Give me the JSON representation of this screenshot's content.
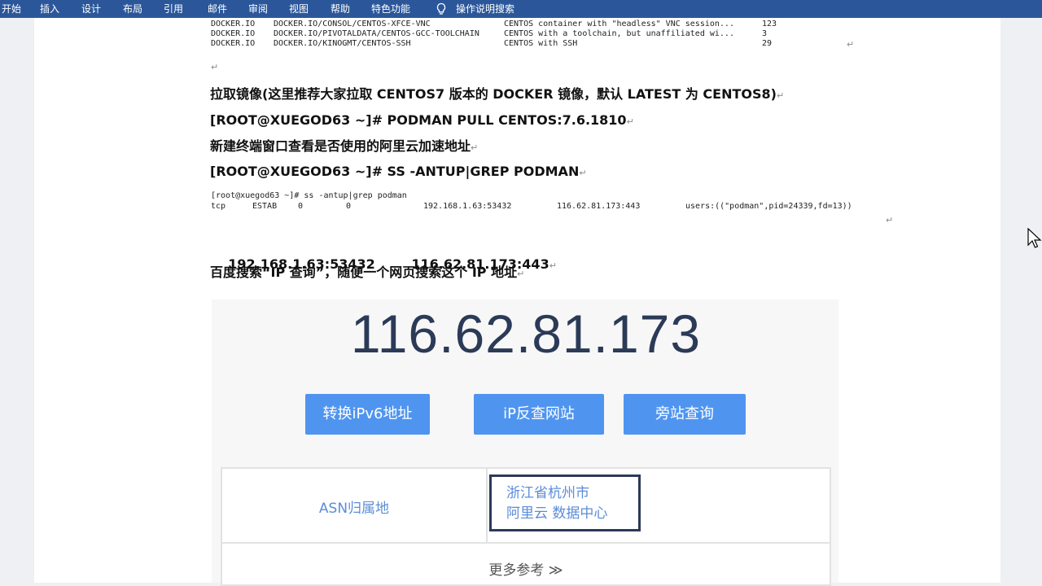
{
  "ribbon": {
    "tabs": [
      "开始",
      "插入",
      "设计",
      "布局",
      "引用",
      "邮件",
      "审阅",
      "视图",
      "帮助",
      "特色功能"
    ],
    "tell_me": "操作说明搜索"
  },
  "doc": {
    "search_results": [
      {
        "index": "DOCKER.IO",
        "name": "DOCKER.IO/CONSOL/CENTOS-XFCE-VNC",
        "description": "CENTOS container with \"headless\" VNC session...",
        "stars": "123"
      },
      {
        "index": "DOCKER.IO",
        "name": "DOCKER.IO/PIVOTALDATA/CENTOS-GCC-TOOLCHAIN",
        "description": "CENTOS with a toolchain, but unaffiliated wi...",
        "stars": "3"
      },
      {
        "index": "DOCKER.IO",
        "name": "DOCKER.IO/KINOGMT/CENTOS-SSH",
        "description": "CENTOS with SSH",
        "stars": "29"
      }
    ],
    "para_mark": "↵",
    "heading_pull": "拉取镜像(这里推荐大家拉取 CENTOS7 版本的 DOCKER 镜像，默认 LATEST 为 CENTOS8)",
    "cmd_pull": "[ROOT@XUEGOD63 ~]# PODMAN PULL CENTOS:7.6.1810",
    "heading_terminal": "新建终端窗口查看是否使用的阿里云加速地址",
    "cmd_ss": "[ROOT@XUEGOD63 ~]# SS -ANTUP|GREP PODMAN",
    "ss_output": {
      "prompt": "[root@xuegod63 ~]# ss -antup|grep podman",
      "proto": "tcp",
      "state": "ESTAB",
      "recv_q": "0",
      "send_q": "0",
      "local": "192.168.1.63:53432",
      "peer": "116.62.81.173:443",
      "process": "users:((\"podman\",pid=24339,fd=13))"
    },
    "addresses": "192.168.1.63:53432        116.62.81.173:443",
    "heading_search": "百度搜索“IP 查询”，随便一个网页搜索这个 IP 地址"
  },
  "ip_lookup": {
    "ip": "116.62.81.173",
    "buttons": [
      "转换iPv6地址",
      "iP反查网站",
      "旁站查询"
    ],
    "asn_label": "ASN归属地",
    "asn_value_line1": "浙江省杭州市",
    "asn_value_line2": "阿里云 数据中心",
    "more": "更多参考 ≫"
  },
  "colors": {
    "ribbon": "#2b579a",
    "button": "#4f95f0",
    "ip_text": "#2b3a57",
    "link_text": "#5b8dd8"
  }
}
